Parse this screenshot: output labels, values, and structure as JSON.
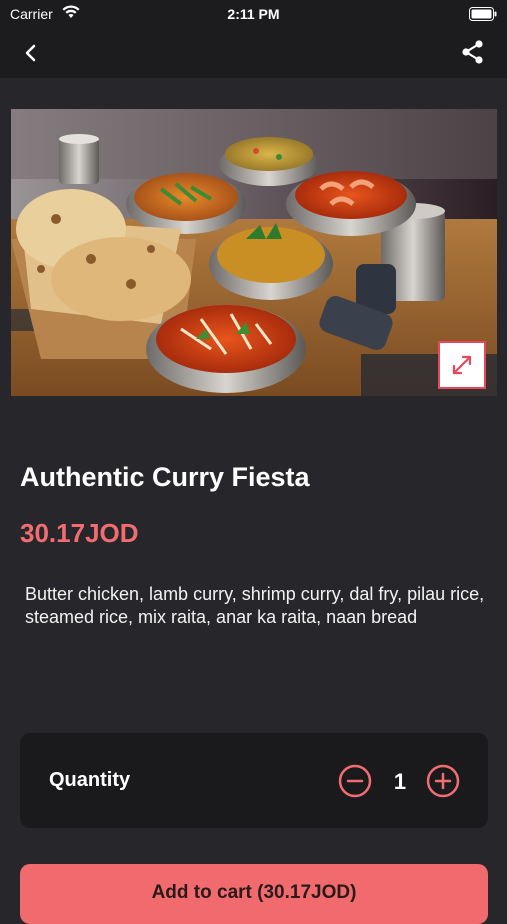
{
  "status_bar": {
    "carrier": "Carrier",
    "time": "2:11 PM"
  },
  "nav": {
    "back_icon": "chevron-left-icon",
    "share_icon": "share-icon"
  },
  "product": {
    "image_alt_icon": "food-image",
    "expand_icon": "expand-arrows-icon",
    "title": "Authentic Curry Fiesta",
    "price": "30.17JOD",
    "description": "Butter chicken, lamb curry, shrimp curry, dal fry, pilau rice, steamed rice, mix raita, anar ka raita, naan bread"
  },
  "quantity": {
    "label": "Quantity",
    "value": "1",
    "minus_icon": "minus-circle-icon",
    "plus_icon": "plus-circle-icon"
  },
  "cart": {
    "label": "Add to cart (30.17JOD)"
  },
  "colors": {
    "accent": "#f26d72",
    "background": "#27272b",
    "card": "#1a1a1d",
    "button": "#f16b6e"
  }
}
